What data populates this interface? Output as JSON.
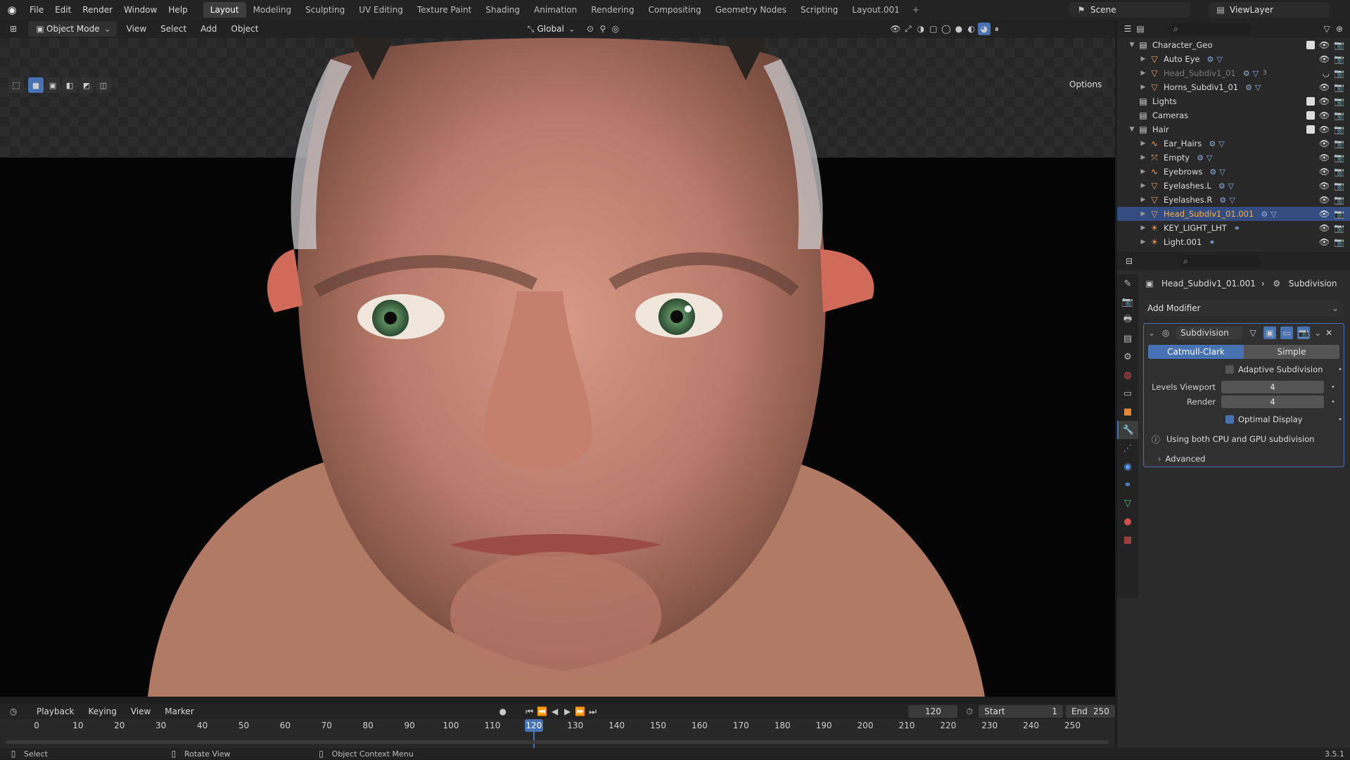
{
  "topbar": {
    "menus": [
      "File",
      "Edit",
      "Render",
      "Window",
      "Help"
    ],
    "workspaces": [
      "Layout",
      "Modeling",
      "Sculpting",
      "UV Editing",
      "Texture Paint",
      "Shading",
      "Animation",
      "Rendering",
      "Compositing",
      "Geometry Nodes",
      "Scripting",
      "Layout.001"
    ],
    "active_workspace": "Layout",
    "scene": "Scene",
    "view_layer": "ViewLayer"
  },
  "viewport_header": {
    "mode": "Object Mode",
    "menus": [
      "View",
      "Select",
      "Add",
      "Object"
    ],
    "orientation": "Global",
    "options": "Options"
  },
  "outliner": {
    "rows": [
      {
        "label": "Character_Geo",
        "indent": 1,
        "type": "collection",
        "expanded": true,
        "checkbox": true
      },
      {
        "label": "Auto Eye",
        "indent": 2,
        "type": "mesh"
      },
      {
        "label": "Head_Subdiv1_01",
        "indent": 2,
        "type": "mesh",
        "dim": true
      },
      {
        "label": "Horns_Subdiv1_01",
        "indent": 2,
        "type": "mesh"
      },
      {
        "label": "Lights",
        "indent": 1,
        "type": "collection",
        "checkbox": true
      },
      {
        "label": "Cameras",
        "indent": 1,
        "type": "collection",
        "checkbox": true
      },
      {
        "label": "Hair",
        "indent": 1,
        "type": "collection",
        "expanded": true,
        "checkbox": true
      },
      {
        "label": "Ear_Hairs",
        "indent": 2,
        "type": "curves"
      },
      {
        "label": "Empty",
        "indent": 2,
        "type": "empty"
      },
      {
        "label": "Eyebrows",
        "indent": 2,
        "type": "curves"
      },
      {
        "label": "Eyelashes.L",
        "indent": 2,
        "type": "mesh"
      },
      {
        "label": "Eyelashes.R",
        "indent": 2,
        "type": "mesh"
      },
      {
        "label": "Head_Subdiv1_01.001",
        "indent": 2,
        "type": "mesh",
        "selected": true
      },
      {
        "label": "KEY_LIGHT_LHT",
        "indent": 2,
        "type": "light"
      },
      {
        "label": "Light.001",
        "indent": 2,
        "type": "light"
      }
    ],
    "badge": "3"
  },
  "properties": {
    "object": "Head_Subdiv1_01.001",
    "modifier_crumb": "Subdivision",
    "add_modifier": "Add Modifier",
    "modifier": {
      "name": "Subdivision",
      "method_a": "Catmull-Clark",
      "method_b": "Simple",
      "adaptive": "Adaptive Subdivision",
      "levels_label": "Levels Viewport",
      "levels_value": "4",
      "render_label": "Render",
      "render_value": "4",
      "optimal": "Optimal Display",
      "info": "Using both CPU and GPU subdivision",
      "advanced": "Advanced"
    }
  },
  "timeline": {
    "menus": [
      "Playback",
      "Keying",
      "View",
      "Marker"
    ],
    "current_frame": "120",
    "start_label": "Start",
    "start": "1",
    "end_label": "End",
    "end": "250",
    "ticks": [
      "0",
      "10",
      "20",
      "30",
      "40",
      "50",
      "60",
      "70",
      "80",
      "90",
      "100",
      "110",
      "120",
      "130",
      "140",
      "150",
      "160",
      "170",
      "180",
      "190",
      "200",
      "210",
      "220",
      "230",
      "240",
      "250"
    ]
  },
  "status": {
    "select": "Select",
    "rotate": "Rotate View",
    "context": "Object Context Menu",
    "version": "3.5.1"
  }
}
